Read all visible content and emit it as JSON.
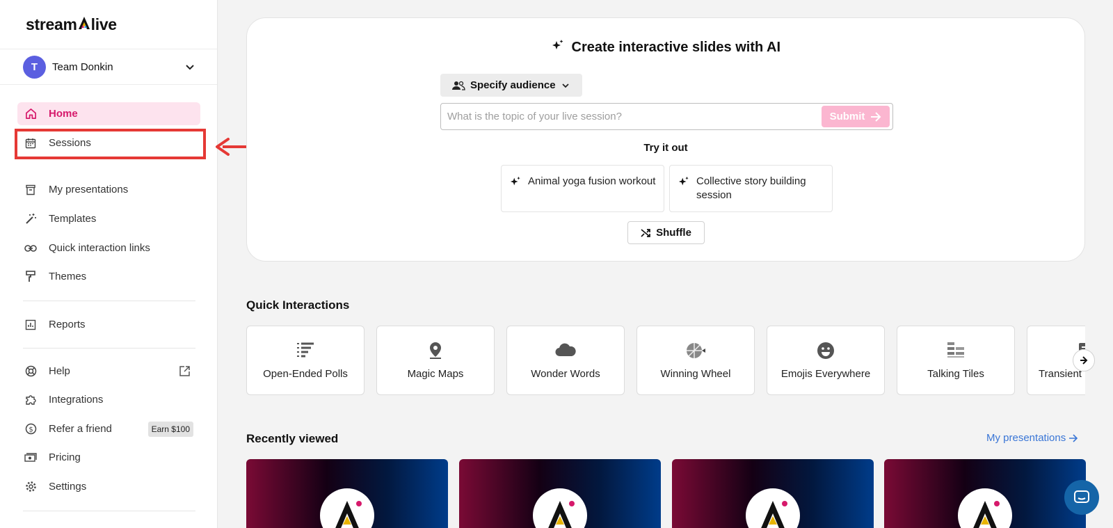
{
  "brand": {
    "logo_pre": "stream",
    "logo_post": "live",
    "accent": "#d6196b"
  },
  "team": {
    "initial": "T",
    "name": "Team Donkin"
  },
  "nav": {
    "home": "Home",
    "sessions": "Sessions",
    "my_presentations": "My presentations",
    "templates": "Templates",
    "quick_links": "Quick interaction links",
    "themes": "Themes",
    "reports": "Reports",
    "help": "Help",
    "integrations": "Integrations",
    "refer": "Refer a friend",
    "earn": "Earn $100",
    "pricing": "Pricing",
    "settings": "Settings"
  },
  "ai": {
    "title": "Create interactive slides with AI",
    "audience": "Specify audience",
    "topic_placeholder": "What is the topic of your live session?",
    "submit": "Submit",
    "try_it": "Try it out",
    "suggestions": [
      "Animal yoga fusion workout",
      "Collective story building session"
    ],
    "shuffle": "Shuffle"
  },
  "quick": {
    "title": "Quick Interactions",
    "items": [
      "Open-Ended Polls",
      "Magic Maps",
      "Wonder Words",
      "Winning Wheel",
      "Emojis Everywhere",
      "Talking Tiles",
      "Transient"
    ]
  },
  "recent": {
    "title": "Recently viewed",
    "link": "My presentations"
  }
}
